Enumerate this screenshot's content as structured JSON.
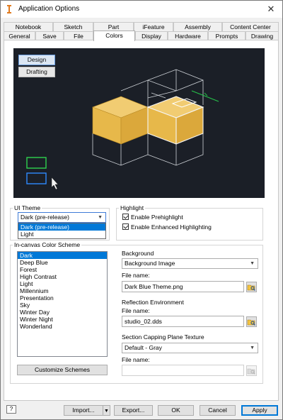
{
  "window": {
    "title": "Application Options",
    "close_glyph": "✕"
  },
  "tabs_top": [
    "Notebook",
    "Sketch",
    "Part",
    "iFeature",
    "Assembly",
    "Content Center"
  ],
  "tabs_bottom": [
    "General",
    "Save",
    "File",
    "Colors",
    "Display",
    "Hardware",
    "Prompts",
    "Drawing"
  ],
  "active_tab": "Colors",
  "preview": {
    "design_label": "Design",
    "drafting_label": "Drafting"
  },
  "ui_theme": {
    "group_label": "UI Theme",
    "selected": "Dark (pre-release)",
    "options": [
      "Dark (pre-release)",
      "Light"
    ]
  },
  "highlight": {
    "group_label": "Highlight",
    "prehighlight_label": "Enable Prehighlight",
    "enhanced_label": "Enable Enhanced Highlighting"
  },
  "color_scheme": {
    "group_label": "In-canvas Color Scheme",
    "items": [
      "Dark",
      "Deep Blue",
      "Forest",
      "High Contrast",
      "Light",
      "Millennium",
      "Presentation",
      "Sky",
      "Winter Day",
      "Winter Night",
      "Wonderland"
    ],
    "selected": "Dark",
    "customize_button": "Customize Schemes"
  },
  "background": {
    "label": "Background",
    "value": "Background Image",
    "file_label": "File name:",
    "file_value": "Dark Blue Theme.png"
  },
  "reflection": {
    "label": "Reflection Environment",
    "file_label": "File name:",
    "file_value": "studio_02.dds"
  },
  "capping": {
    "label": "Section Capping Plane Texture",
    "value": "Default - Gray",
    "file_label": "File name:",
    "file_value": ""
  },
  "footer": {
    "help_glyph": "?",
    "import_label": "Import...",
    "export_label": "Export...",
    "ok_label": "OK",
    "cancel_label": "Cancel",
    "apply_label": "Apply"
  },
  "colors": {
    "accent": "#0078d7",
    "preview_bg": "#1b1f27",
    "cube_fill": "#e7b84a"
  }
}
